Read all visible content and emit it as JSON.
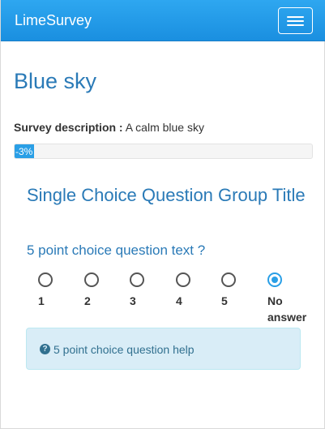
{
  "navbar": {
    "brand": "LimeSurvey",
    "menu_icon": "hamburger-icon"
  },
  "survey": {
    "title": "Blue sky",
    "description_label": "Survey description :",
    "description": "A calm blue sky",
    "progress_text": "-3%",
    "progress_percent": -3
  },
  "group": {
    "title": "Single Choice Question Group Title"
  },
  "question": {
    "text": "5 point choice question text ?",
    "choices": [
      {
        "label": "1",
        "checked": false
      },
      {
        "label": "2",
        "checked": false
      },
      {
        "label": "3",
        "checked": false
      },
      {
        "label": "4",
        "checked": false
      },
      {
        "label": "5",
        "checked": false
      },
      {
        "label": "No answer",
        "checked": true
      }
    ],
    "help_icon": "question-circle-icon",
    "help": "5 point choice question help"
  },
  "colors": {
    "navbar": "#1a8fe0",
    "title": "#2a7ab7",
    "help_bg": "#d9edf7",
    "help_text": "#31708f"
  }
}
